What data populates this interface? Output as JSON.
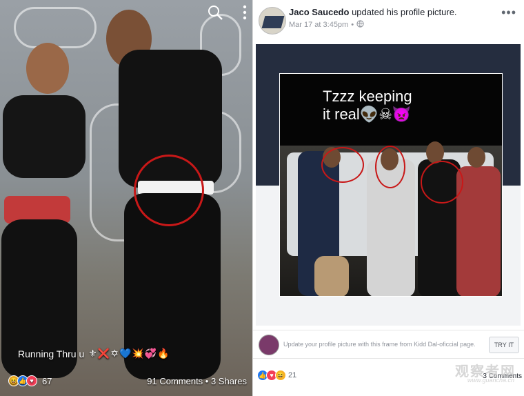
{
  "left_panel": {
    "caption_text": "Running Thru u",
    "caption_emojis": "⚜❌✡💙💥💞🔥",
    "reaction_count": "67",
    "stats": "91 Comments • 3 Shares"
  },
  "post": {
    "author": "Jaco Saucedo",
    "action": "updated his profile picture.",
    "timestamp": "Mar 17 at 3:45pm",
    "separator": "•",
    "more_label": "•••",
    "photo_caption_line1": "Tzzz keeping",
    "photo_caption_line2": "it real👽☠👿",
    "promo_text": "Update your profile picture with this frame from Kidd Dal-oficcial page.",
    "try_label": "TRY IT",
    "reaction_count": "21",
    "comments": "3 Comments"
  },
  "watermark": {
    "main": "观察者网",
    "sub": "www.guancha.cn"
  },
  "colors": {
    "fb_blue": "#3b5998",
    "like_blue": "#2078f4",
    "love_red": "#f33e58",
    "haha_yellow": "#f7b125",
    "highlight_red": "#c81818"
  }
}
